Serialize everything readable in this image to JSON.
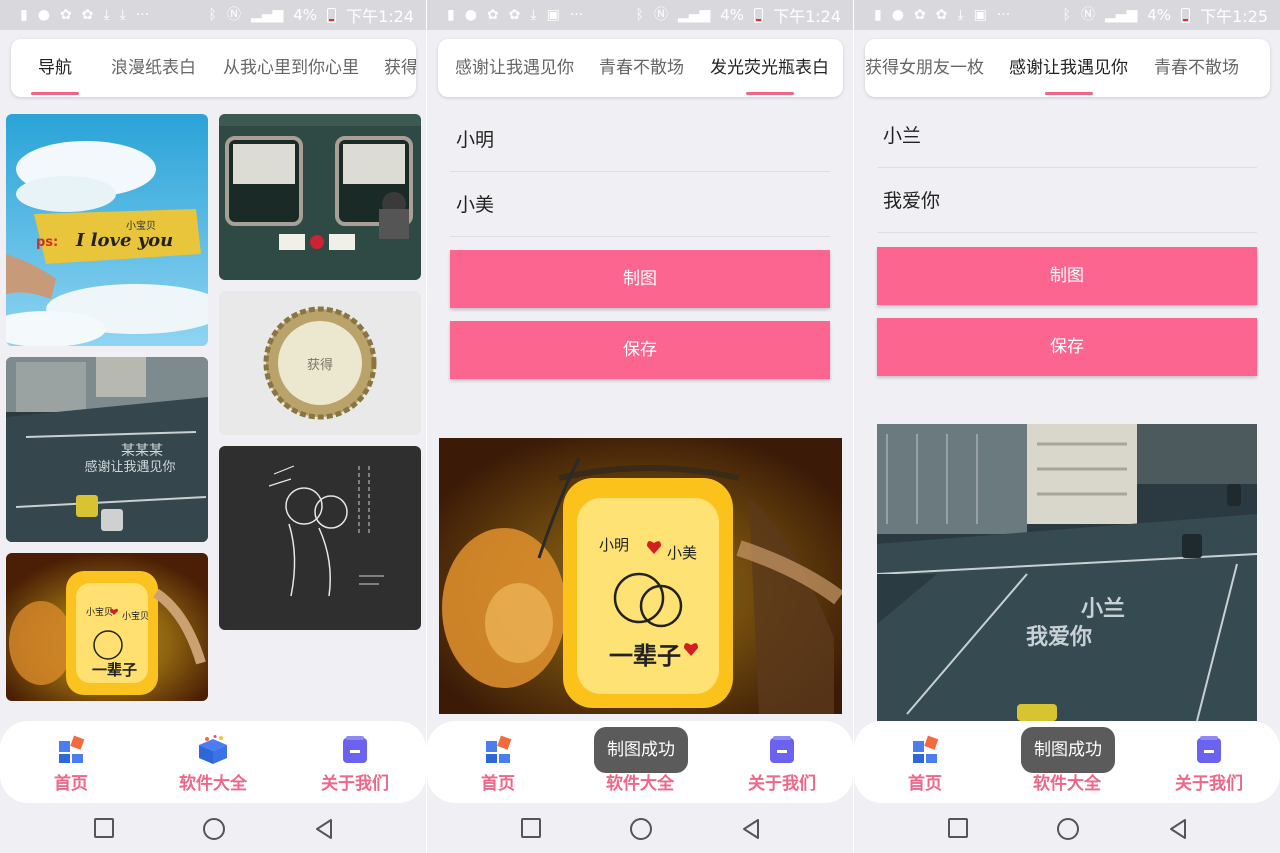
{
  "status_bar": {
    "screens": [
      {
        "battery": "4%",
        "time": "下午1:24"
      },
      {
        "battery": "4%",
        "time": "下午1:24"
      },
      {
        "battery": "4%",
        "time": "下午1:25"
      }
    ]
  },
  "screen1": {
    "tabs": [
      "导航",
      "浪漫纸表白",
      "从我心里到你心里",
      "获得"
    ],
    "active_tab": "导航",
    "images": [
      "love-note-sky-image",
      "train-window-image",
      "bottle-cap-image",
      "street-crossing-image",
      "chalkboard-couple-image",
      "glow-jar-image"
    ]
  },
  "screen2": {
    "tabs": [
      "感谢让我遇见你",
      "青春不散场",
      "发光荧光瓶表白"
    ],
    "active_tab": "发光荧光瓶表白",
    "field1": "小明",
    "field2": "小美",
    "draw_button": "制图",
    "save_button": "保存",
    "preview": {
      "name1": "小明",
      "name2": "小美",
      "caption": "一辈子"
    },
    "toast": "制图成功"
  },
  "screen3": {
    "tabs": [
      "获得女朋友一枚",
      "感谢让我遇见你",
      "青春不散场"
    ],
    "active_tab": "感谢让我遇见你",
    "field1": "小兰",
    "field2": "我爱你",
    "draw_button": "制图",
    "save_button": "保存",
    "preview": {
      "line1": "小兰",
      "line2": "我爱你"
    },
    "toast": "制图成功"
  },
  "bottom_nav": {
    "items": [
      {
        "label": "首页",
        "icon": "home-grid-icon"
      },
      {
        "label": "软件大全",
        "icon": "gift-box-icon"
      },
      {
        "label": "关于我们",
        "icon": "about-box-icon"
      }
    ]
  },
  "colors": {
    "accent": "#fb6590",
    "nav_label": "#ee6688",
    "background": "#f0eff4",
    "toast": "#5b5b5b"
  },
  "thumbnail_text": {
    "love_note": "I love you",
    "love_note_prefix": "ps:",
    "love_note_name": "小宝贝",
    "street_name": "某某某",
    "street_phrase": "感谢让我遇见你",
    "cap_line1": "获得",
    "jar_name1": "小宝贝",
    "jar_name2": "小宝贝",
    "jar_caption": "一辈子"
  }
}
